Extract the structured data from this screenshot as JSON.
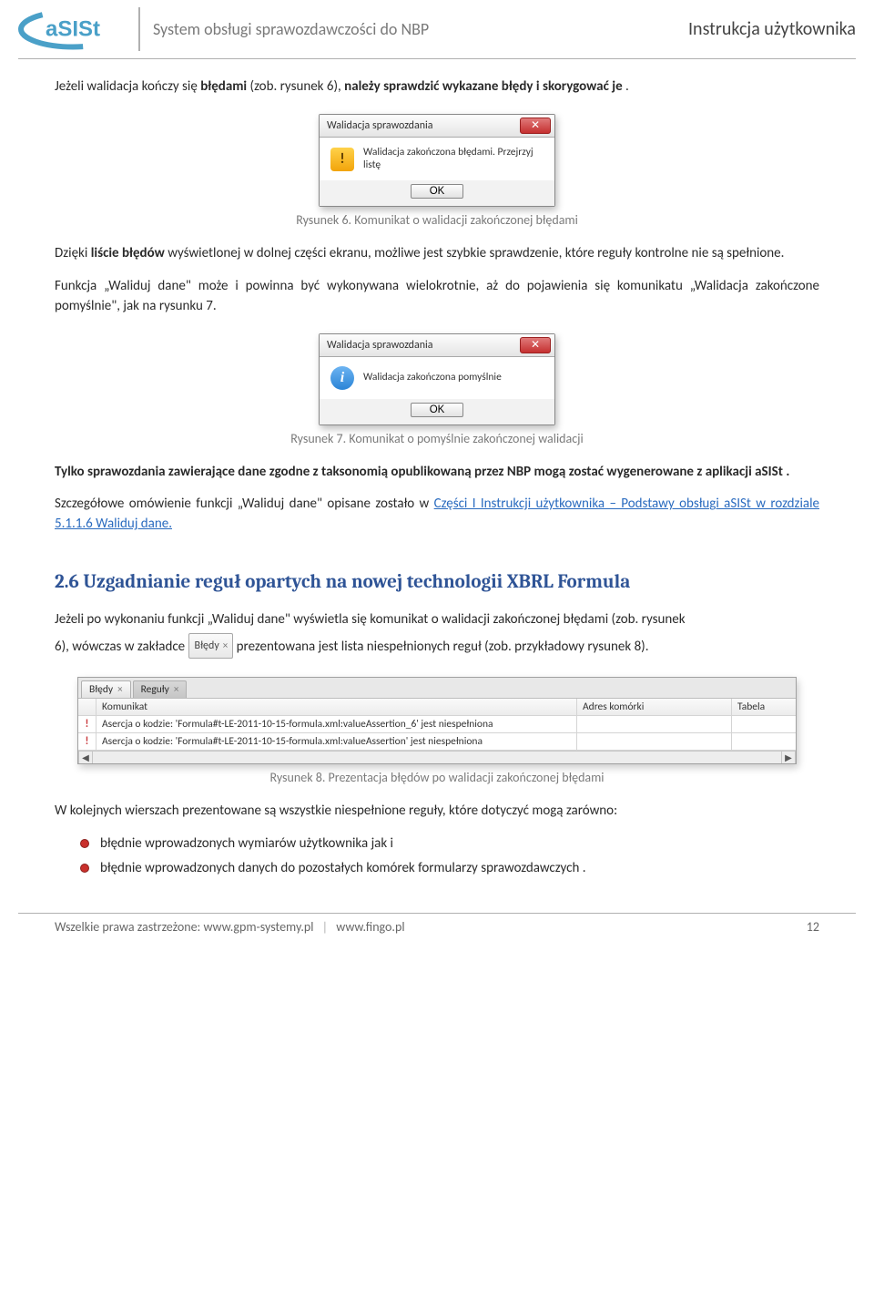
{
  "header": {
    "subtitle": "System obsługi sprawozdawczości do NBP",
    "right": "Instrukcja użytkownika"
  },
  "p1": {
    "a": "Jeżeli walidacja kończy się  ",
    "b": "błędami",
    "c": " (zob. rysunek 6), ",
    "d": "należy sprawdzić wykazane błędy i skorygować je",
    "e": " ."
  },
  "dialog1": {
    "title": "Walidacja sprawozdania",
    "close": "✕",
    "msg": "Walidacja zakończona błędami. Przejrzyj listę",
    "ok": "OK"
  },
  "cap1": "Rysunek 6. Komunikat o walidacji zakończonej błędami",
  "p2": {
    "a": "Dzięki ",
    "b": "liście błędów",
    "c": " wyświetlonej w dolnej części ekranu, możliwe jest szybkie sprawdzenie,  które reguły kontrolne nie są spełnione."
  },
  "p3": "Funkcja „Waliduj dane\" może i powinna być wykonywana wielokrotnie, aż do pojawienia się komunikatu „Walidacja zakończone pomyślnie\", jak na rysunku 7.",
  "dialog2": {
    "title": "Walidacja sprawozdania",
    "close": "✕",
    "msg": "Walidacja zakończona pomyślnie",
    "ok": "OK"
  },
  "cap2": "Rysunek 7. Komunikat o pomyślnie zakończonej walidacji",
  "p4": {
    "a": "Tylko sprawozdania zawierające dane zgodne z taksonomią opublikowaną przez NBP mogą zostać wygenerowane z aplikacji aSISt .",
    "b": "Szczegółowe omówienie funkcji „Waliduj dane\" opisane zostało  w  ",
    "link": "Części I Instrukcji użytkownika – Podstawy obsługi aSISt w rozdziale  5.1.1.6 Waliduj dane."
  },
  "sect": "2.6  Uzgadnianie reguł opartych na nowej technologii XBRL Formula",
  "p5": {
    "a": "Jeżeli po wykonaniu funkcji „Waliduj dane\" wyświetla się komunikat o walidacji zakończonej błędami (zob. rysunek",
    "b": "6),  wówczas w zakładce",
    "tab": "Błędy",
    "c": "prezentowana jest lista niespełnionych reguł (zob. przykładowy rysunek 8)."
  },
  "err": {
    "tabs": [
      "Błędy",
      "Reguły"
    ],
    "cols": [
      "",
      "Komunikat",
      "Adres komórki",
      "Tabela"
    ],
    "rows": [
      "Asercja o kodzie: 'Formula#t-LE-2011-10-15-formula.xml:valueAssertion_6' jest niespełniona",
      "Asercja o kodzie: 'Formula#t-LE-2011-10-15-formula.xml:valueAssertion' jest niespełniona"
    ]
  },
  "cap3": "Rysunek 8. Prezentacja błędów po walidacji zakończonej błędami",
  "p6": "W kolejnych wierszach prezentowane są wszystkie niespełnione reguły, które dotyczyć mogą zarówno:",
  "bul": [
    "błędnie wprowadzonych wymiarów użytkownika  jak i",
    "błędnie wprowadzonych danych do pozostałych komórek formularzy sprawozdawczych ."
  ],
  "footer": {
    "left_a": "Wszelkie prawa zastrzeżone: www.gpm-systemy.pl ",
    "left_b": " www.fingo.pl",
    "page": "12"
  },
  "icons": {
    "warn": "!",
    "info": "i",
    "bang": "!",
    "x": "×",
    "left": "◀",
    "right": "▶"
  }
}
